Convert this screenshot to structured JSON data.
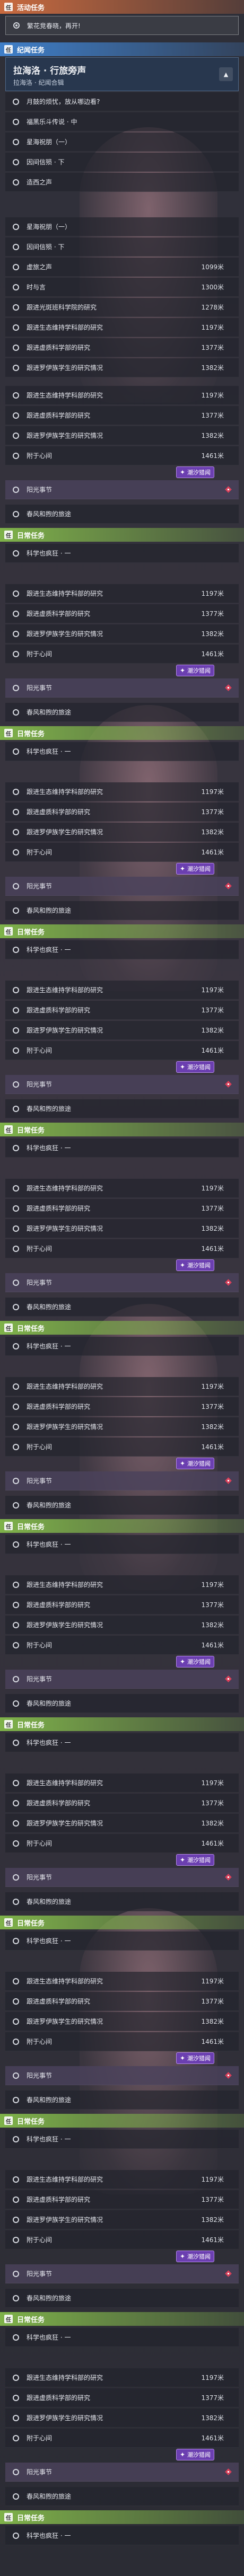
{
  "categories": {
    "event": "活动任务",
    "plot": "纪闻任务",
    "daily": "日常任务"
  },
  "category_badge": "任",
  "event_quest": "繁花竞春晓，再开!",
  "hero": {
    "title": "拉海洛 · 行旅旁声",
    "subtitle": "拉海洛 · 纪闻合辑",
    "chevron": "▲"
  },
  "plot_items": {
    "a": "月鼓的烦忧，放从哪边看?",
    "b": "福黑乐斗传说 · 中",
    "c": "星海祝朋（一）",
    "d": "因间信殒 · 下",
    "e": "造西之声"
  },
  "tail_a": {
    "a1": "星海祝朋（一）",
    "a2": "因间信殒 · 下",
    "a3": "虚旅之声",
    "a4": "时与言",
    "a5": "跟进光斑班科学院的研究",
    "a6": "跟进生态维持学科部的研究",
    "a7": "跟进虚质科学部的研究",
    "a8": "跟进罗伊族学生的研究情况"
  },
  "dist": {
    "d1099": "1099米",
    "d1300": "1300米",
    "d1278": "1278米",
    "d1197": "1197米",
    "d1377": "1377米",
    "d1382": "1382米",
    "d1461": "1461米"
  },
  "daily": {
    "eco": "跟进生态维持学科部的研究",
    "void": "跟进虚质科学部的研究",
    "loy": "跟进罗伊族学生的研究情况",
    "mind": "附于心间",
    "sun": "阳光事节",
    "wind": "春风和煦的旅途",
    "sci": "科学也疯狂 · 一"
  },
  "tag_label": "潮汐猎闻",
  "colors": {
    "event": "#c96a3f",
    "plot": "#3f7fc9",
    "daily": "#7fb24a",
    "tag": "#6b3fb0",
    "marker": "#d8405a"
  }
}
